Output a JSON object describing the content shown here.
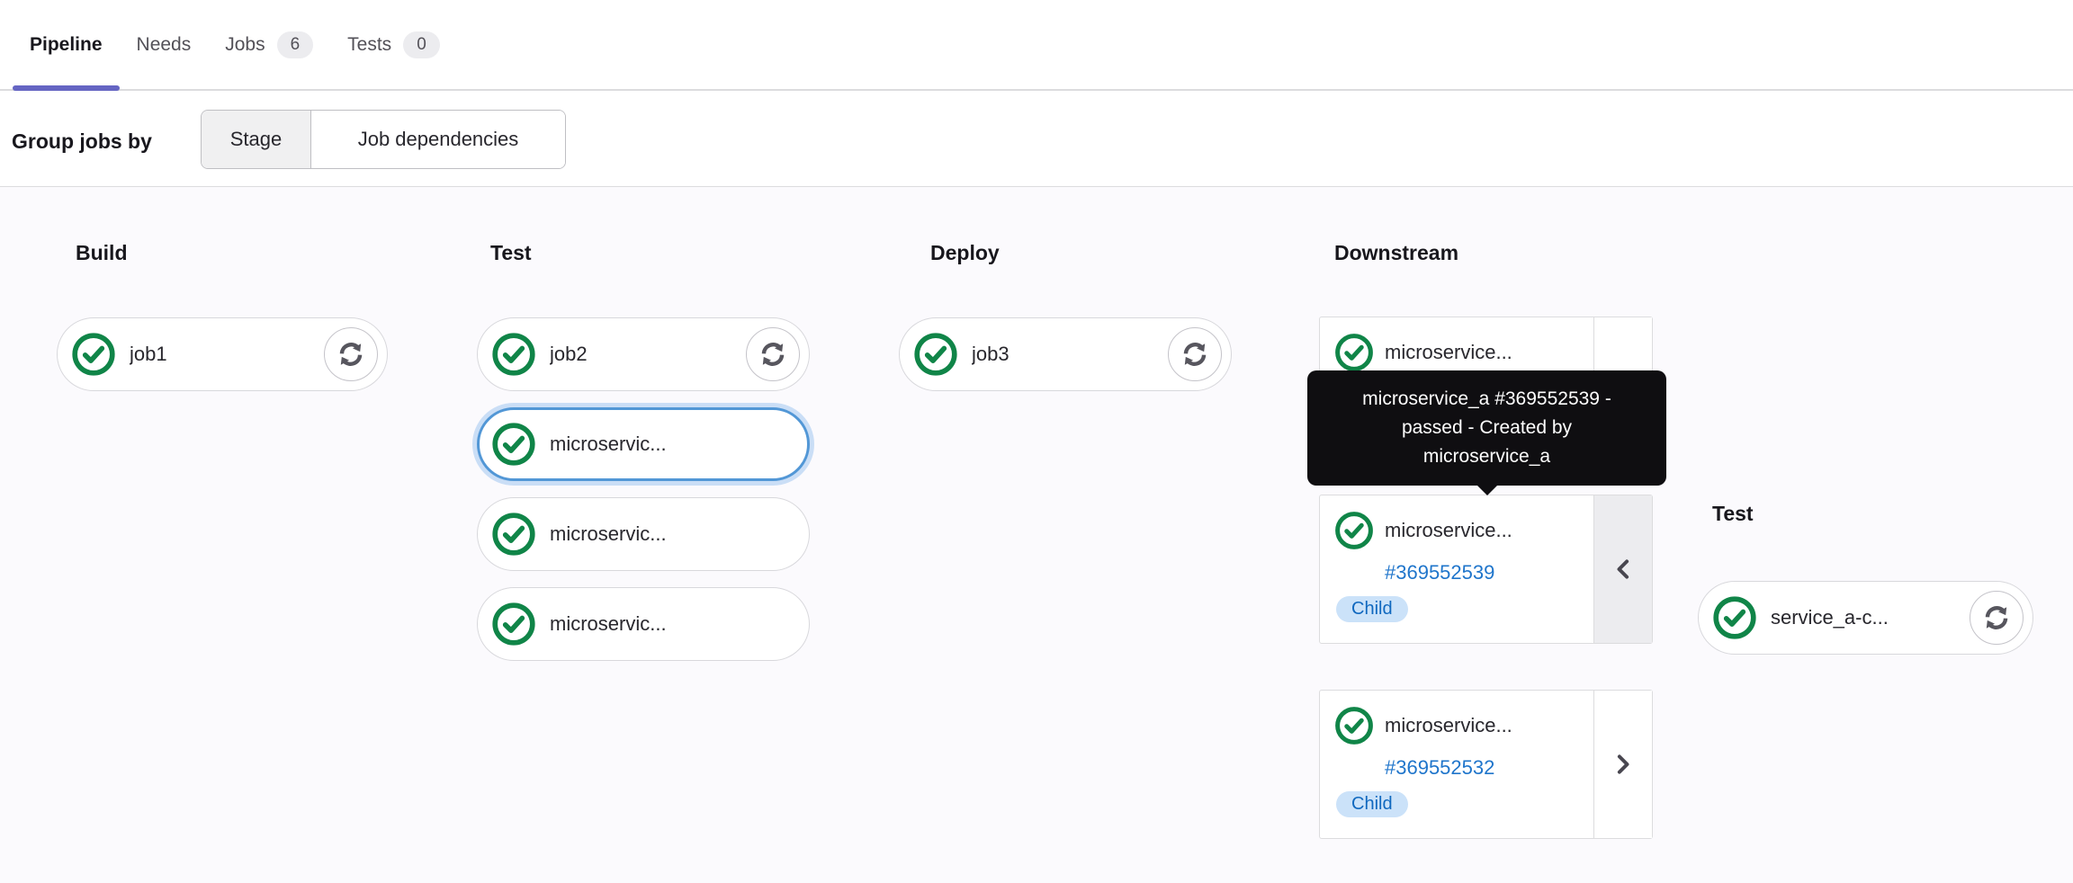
{
  "tabs": {
    "pipeline": "Pipeline",
    "needs": "Needs",
    "jobs": "Jobs",
    "jobs_count": "6",
    "tests": "Tests",
    "tests_count": "0"
  },
  "toolbar": {
    "group_label": "Group jobs by",
    "stage_option": "Stage",
    "job_dependencies_option": "Job dependencies"
  },
  "stages": {
    "build": {
      "title": "Build"
    },
    "test": {
      "title": "Test"
    },
    "deploy": {
      "title": "Deploy"
    },
    "downstream": {
      "title": "Downstream"
    },
    "downstream_test": {
      "title": "Test"
    }
  },
  "jobs": {
    "job1": {
      "name": "job1",
      "status": "passed"
    },
    "job2": {
      "name": "job2",
      "status": "passed"
    },
    "job3": {
      "name": "job3",
      "status": "passed"
    },
    "ms_trigger_1": {
      "name": "microservic...",
      "status": "passed",
      "selected": true
    },
    "ms_trigger_2": {
      "name": "microservic...",
      "status": "passed"
    },
    "ms_trigger_3": {
      "name": "microservic...",
      "status": "passed"
    },
    "service_a": {
      "name": "service_a-c...",
      "status": "passed"
    }
  },
  "downstream_cards": [
    {
      "name": "microservice...",
      "status": "passed"
    },
    {
      "name": "microservice...",
      "pipeline_id": "#369552539",
      "badge": "Child",
      "status": "passed",
      "chevron": "left"
    },
    {
      "name": "microservice...",
      "pipeline_id": "#369552532",
      "badge": "Child",
      "status": "passed",
      "chevron": "right"
    }
  ],
  "tooltip": {
    "text": "microservice_a #369552539 - passed - Created by microservice_a"
  },
  "colors": {
    "accent_indigo": "#6565c3",
    "success_green": "#108548",
    "link_blue": "#1f75cb",
    "badge_info_bg": "#cbe2f9",
    "selected_ring_blue": "#5297d6"
  }
}
